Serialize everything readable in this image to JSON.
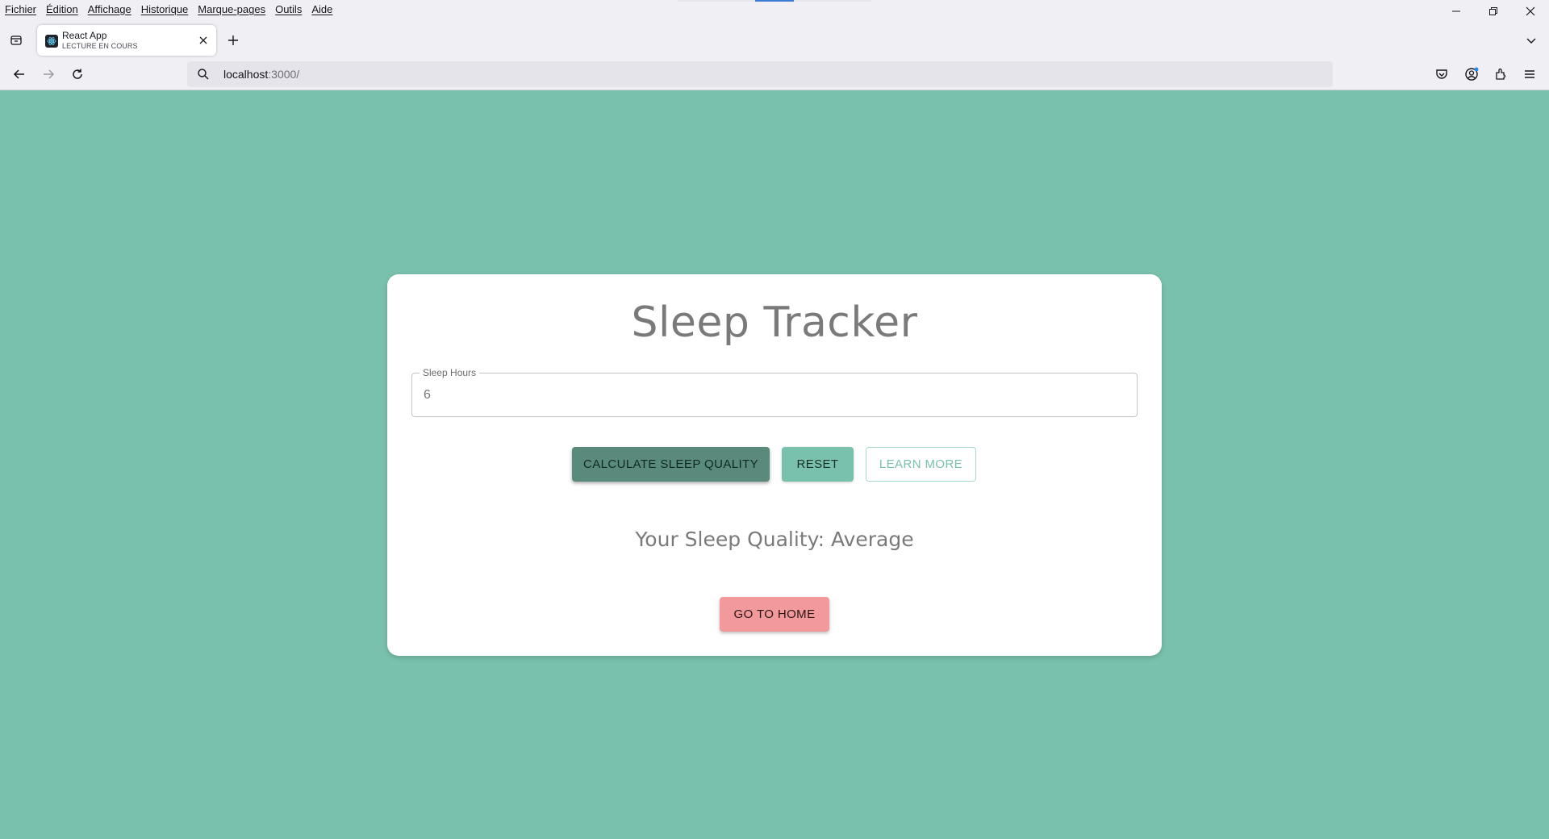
{
  "browser": {
    "menu": [
      "Fichier",
      "Édition",
      "Affichage",
      "Historique",
      "Marque-pages",
      "Outils",
      "Aide"
    ],
    "tab": {
      "title": "React App",
      "subtitle": "LECTURE EN COURS"
    },
    "url": {
      "host": "localhost",
      "path": ":3000/"
    },
    "icons": [
      "tab-list-icon",
      "close-tab-icon",
      "new-tab-icon",
      "back-icon",
      "forward-icon",
      "reload-icon",
      "search-icon",
      "pocket-icon",
      "account-icon",
      "extensions-icon",
      "menu-icon"
    ]
  },
  "app": {
    "title": "Sleep Tracker",
    "input": {
      "label": "Sleep Hours",
      "value": "6"
    },
    "buttons": {
      "calculate": "CALCULATE SLEEP QUALITY",
      "reset": "RESET",
      "learn_more": "LEARN MORE",
      "home": "GO TO HOME"
    },
    "result": "Your Sleep Quality: Average"
  },
  "colors": {
    "page_background": "#79c1ac",
    "calculate_button": "#5a8a7b",
    "reset_button": "#79c1ac",
    "home_button": "#f29a9b"
  }
}
